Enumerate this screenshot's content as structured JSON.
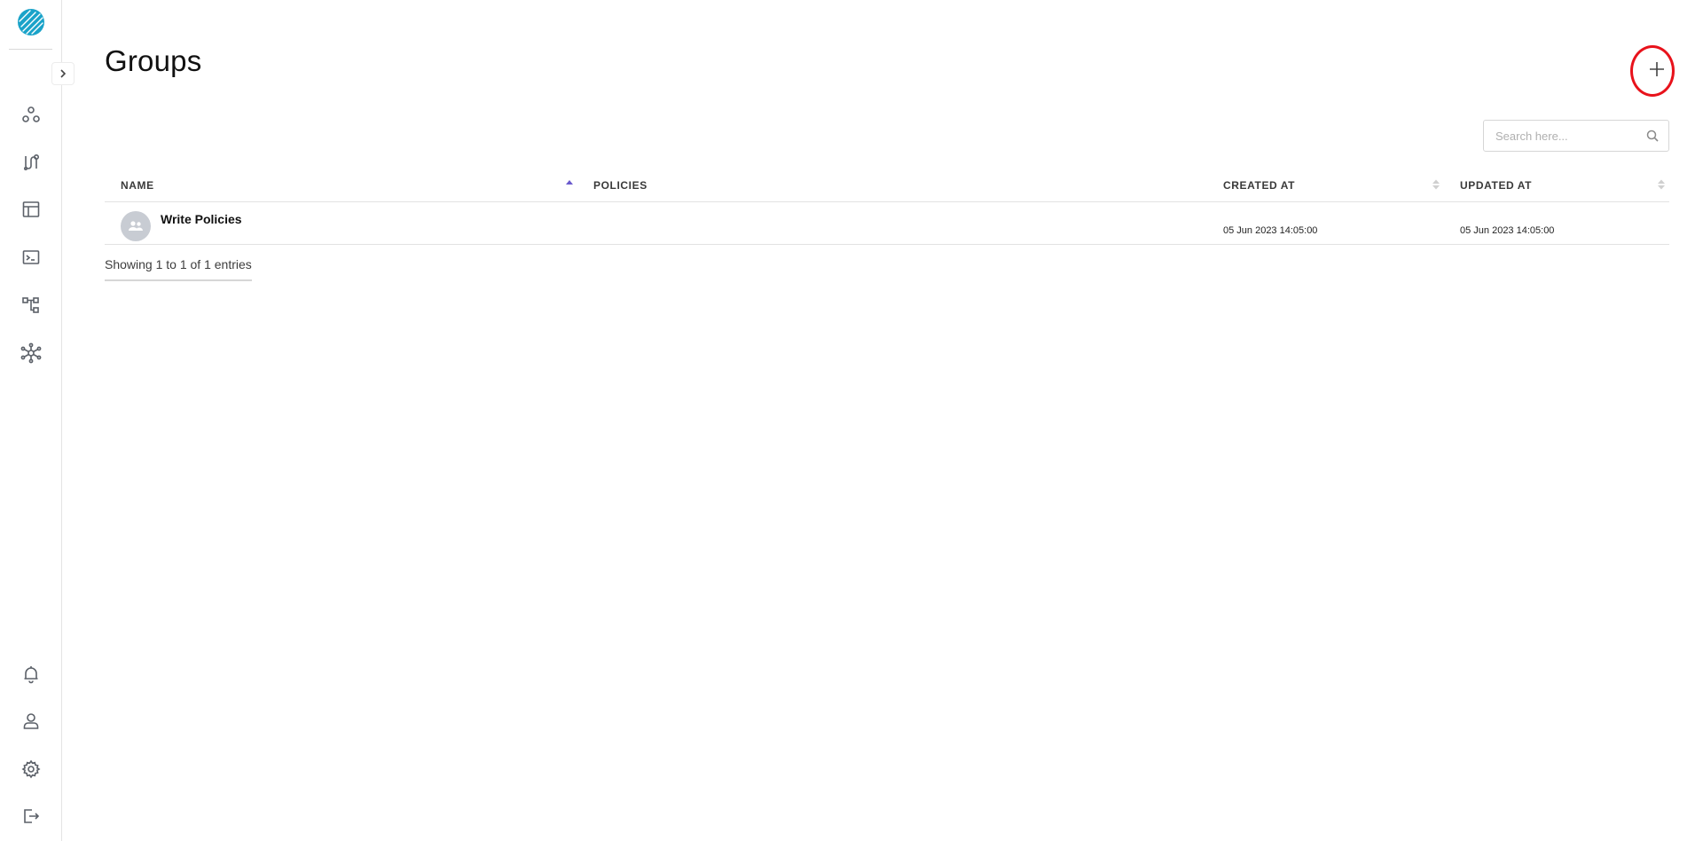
{
  "page": {
    "title": "Groups"
  },
  "icons": {
    "logo": "logo-icon",
    "expand": "chevron-right-icon",
    "nav": [
      "nodes-icon",
      "pipeline-icon",
      "table-layout-icon",
      "terminal-icon",
      "hierarchy-icon",
      "network-icon"
    ],
    "bottom_nav": [
      "bell-icon",
      "user-icon",
      "gear-icon",
      "logout-icon"
    ],
    "add": "plus-icon",
    "search": "search-icon",
    "avatar": "group-icon"
  },
  "colors": {
    "accent": "#1aa3c9",
    "highlight_ring": "#e8121b",
    "sort_active": "#6a5acd"
  },
  "search": {
    "placeholder": "Search here..."
  },
  "table": {
    "columns": [
      "NAME",
      "POLICIES",
      "CREATED AT",
      "UPDATED AT"
    ],
    "rows": [
      {
        "name": "Write Policies",
        "policies": "",
        "created_at": "05 Jun 2023 14:05:00",
        "updated_at": "05 Jun 2023 14:05:00"
      }
    ]
  },
  "footer": {
    "info": "Showing 1 to 1 of 1 entries"
  }
}
